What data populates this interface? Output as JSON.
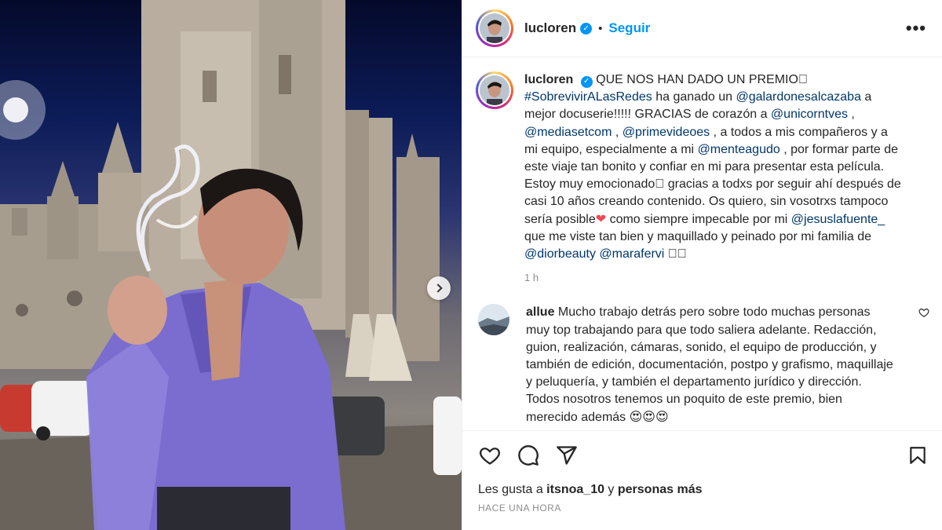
{
  "post": {
    "username": "lucloren",
    "follow_label": "Seguir",
    "dot": "•",
    "more": "•••",
    "verified_glyph": "✓"
  },
  "caption": {
    "username": "lucloren",
    "title": "QUE NOS HAN DADO UN PREMIO",
    "tofu": "⃞",
    "line1_tag": "#SobrevivirALasRedes",
    "line1_text": " ha ganado un ",
    "mention_galardones": "@galardonesalcazaba",
    "text_a": " a mejor docuserie!!!!! GRACIAS de corazón a ",
    "mention_unicorn": "@unicorntves",
    "text_b": " , ",
    "mention_mediaset": "@mediasetcom",
    "text_c": " , ",
    "mention_prime": "@primevideoes",
    "text_d": " , a todos a mis compañeros y a mi equipo, especialmente a mi ",
    "mention_mente": "@menteagudo",
    "text_e": " , por formar parte de este viaje tan bonito y confiar en mi para presentar esta película. Estoy muy emocionado",
    "text_f": " gracias a todxs por seguir ahí después de casi 10 años creando contenido. Os quiero, sin vosotrxs tampoco sería posible",
    "heart": "❤",
    "text_g": " como siempre impecable por mi ",
    "mention_jesus": "@jesuslafuente_",
    "text_h": " que me viste tan bien y maquillado y peinado por mi familia de ",
    "mention_dior": "@diorbeauty",
    "text_i": " ",
    "mention_mara": "@marafervi",
    "end_tofu": " ⃞⃞",
    "timestamp": "1 h"
  },
  "comment": {
    "username": "allue",
    "text": "Mucho trabajo detrás pero sobre todo muchas personas muy top trabajando para que todo saliera adelante. Redacción, guion, realización, cámaras, sonido, el equipo de producción, y también de edición, documentación, postpo y grafismo, maquillaje y peluquería, y también el departamento jurídico y dirección. Todos nosotros tenemos un poquito de este premio, bien merecido además",
    "emojis": " 😍😍😍",
    "like_icon": "heart-outline-icon"
  },
  "footer": {
    "likes_prefix": "Les gusta a ",
    "likes_user": "itsnoa_10",
    "likes_mid": " y ",
    "likes_suffix": "personas más",
    "time_ago": "HACE UNA HORA"
  },
  "icons": [
    "heart-icon",
    "comment-icon",
    "share-icon",
    "bookmark-icon",
    "chevron-right-icon",
    "more-icon",
    "verified-icon"
  ],
  "colors": {
    "accent": "#0095f6",
    "link": "#00376b",
    "muted": "#8e8e8e",
    "heart": "#ed4956"
  }
}
